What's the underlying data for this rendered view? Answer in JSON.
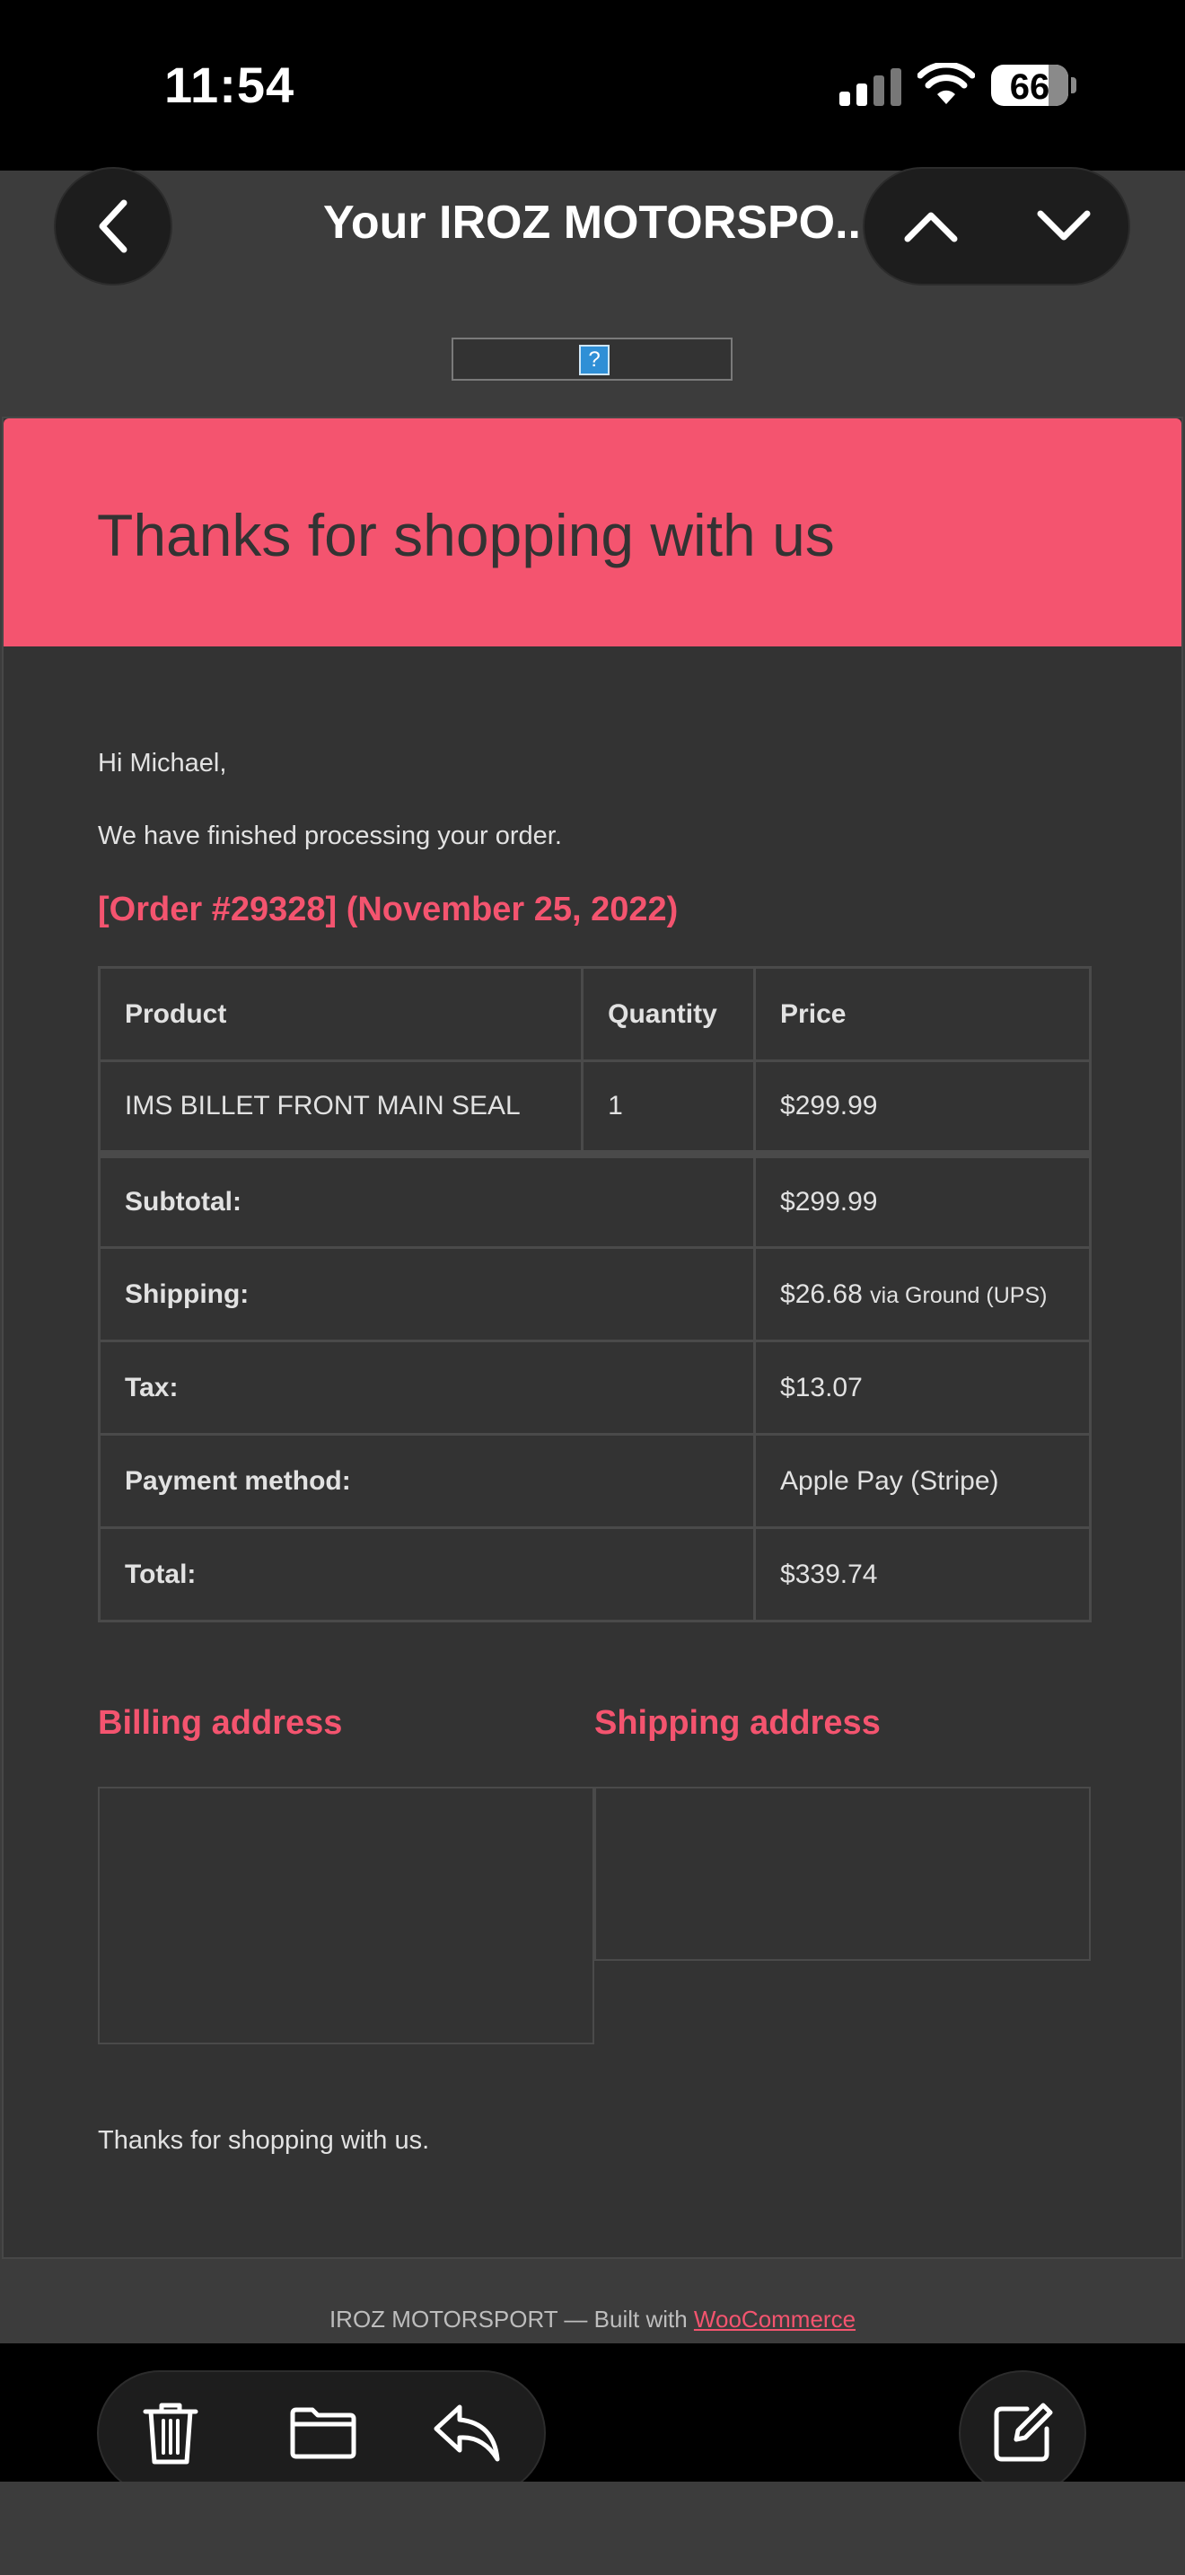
{
  "status_bar": {
    "time": "11:54",
    "battery": "66"
  },
  "nav": {
    "title": "Your IROZ MOTORSPO..."
  },
  "email": {
    "image_placeholder": "?",
    "header_title": "Thanks for shopping with us",
    "greeting": "Hi Michael,",
    "intro": "We have finished processing your order.",
    "order_title": "[Order #29328] (November 25, 2022)",
    "table": {
      "headers": [
        "Product",
        "Quantity",
        "Price"
      ],
      "item": {
        "product": "IMS BILLET FRONT MAIN SEAL",
        "quantity": "1",
        "price": "$299.99"
      },
      "totals": [
        {
          "label": "Subtotal:",
          "value": "$299.99"
        },
        {
          "label": "Shipping:",
          "value": "$26.68",
          "note": "via Ground (UPS)"
        },
        {
          "label": "Tax:",
          "value": "$13.07"
        },
        {
          "label": "Payment method:",
          "value": "Apple Pay (Stripe)"
        },
        {
          "label": "Total:",
          "value": "$339.74"
        }
      ]
    },
    "billing_title": "Billing address",
    "shipping_title": "Shipping address",
    "closing": "Thanks for shopping with us.",
    "footer_prefix": "IROZ MOTORSPORT — Built with ",
    "footer_link": "WooCommerce"
  },
  "colors": {
    "accent": "#f4546f",
    "background": "#3c3c3c",
    "panel": "#333333"
  },
  "icons": [
    "back-chevron-icon",
    "chevron-up-icon",
    "chevron-down-icon",
    "trash-icon",
    "folder-icon",
    "reply-icon",
    "compose-icon",
    "signal-icon",
    "wifi-icon",
    "battery-icon"
  ]
}
